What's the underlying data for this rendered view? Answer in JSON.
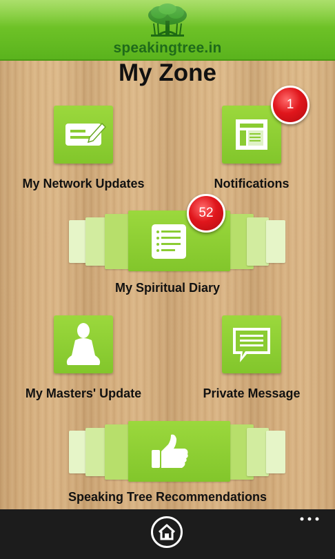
{
  "header": {
    "logo_text": "speakingtree.in",
    "colors": {
      "bar_top": "#8fd43a",
      "bar_bottom": "#5ab31d",
      "logo_text": "#1f6b1a"
    }
  },
  "title": "My Zone",
  "tiles": {
    "network_updates": {
      "label": "My Network Updates",
      "icon": "compose-icon"
    },
    "notifications": {
      "label": "Notifications",
      "icon": "news-page-icon",
      "badge": "1"
    },
    "spiritual_diary": {
      "label": "My Spiritual Diary",
      "icon": "notebook-icon",
      "badge": "52"
    },
    "masters_update": {
      "label": "My Masters' Update",
      "icon": "meditating-person-icon"
    },
    "private_message": {
      "label": "Private Message",
      "icon": "speech-bubble-icon"
    },
    "recommendations": {
      "label": "Speaking Tree Recommendations",
      "icon": "thumbs-up-icon"
    }
  },
  "app_bar": {
    "home_icon": "home-icon",
    "more_icon": "ellipsis-icon"
  },
  "colors": {
    "tile": "#82c62b",
    "badge": "#e0161c",
    "app_bar": "#1c1c1c"
  }
}
